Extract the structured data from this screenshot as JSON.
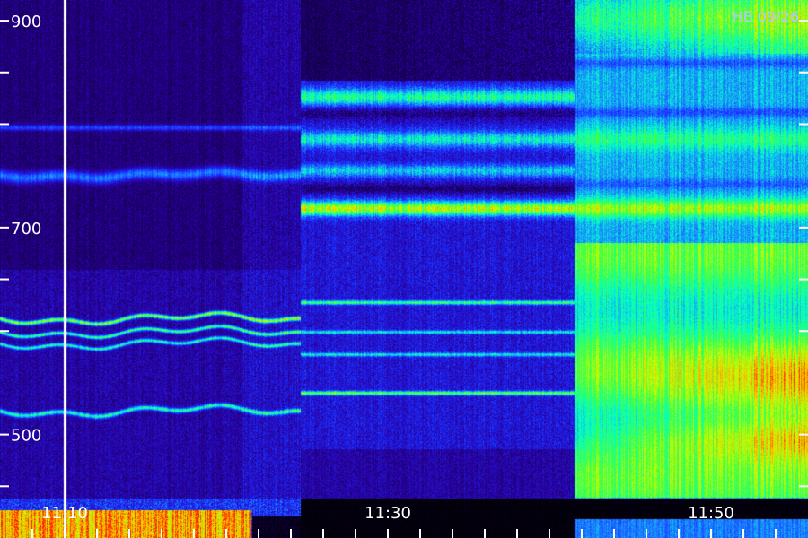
{
  "chart_data": {
    "type": "heatmap",
    "title": "HB 09/26",
    "xlabel": "",
    "ylabel": "",
    "x_range": [
      "11:06",
      "11:56"
    ],
    "y_range": [
      400,
      920
    ],
    "x_ticks": [
      {
        "label": "11:10",
        "value": "11:10"
      },
      {
        "label": "11:30",
        "value": "11:30"
      },
      {
        "label": "11:50",
        "value": "11:50"
      }
    ],
    "y_ticks": [
      {
        "label": "900",
        "value": 900
      },
      {
        "label": "",
        "value": 850
      },
      {
        "label": "",
        "value": 800
      },
      {
        "label": "700",
        "value": 700
      },
      {
        "label": "",
        "value": 650
      },
      {
        "label": "",
        "value": 600
      },
      {
        "label": "500",
        "value": 500
      },
      {
        "label": "",
        "value": 450
      }
    ],
    "colorscale": [
      "#000000",
      "#2a00a0",
      "#1a2cff",
      "#1a8cff",
      "#00ffd0",
      "#40ff40",
      "#c8ff00",
      "#ffb000",
      "#ff2000"
    ],
    "marker_time": "11:10",
    "grid": false
  }
}
